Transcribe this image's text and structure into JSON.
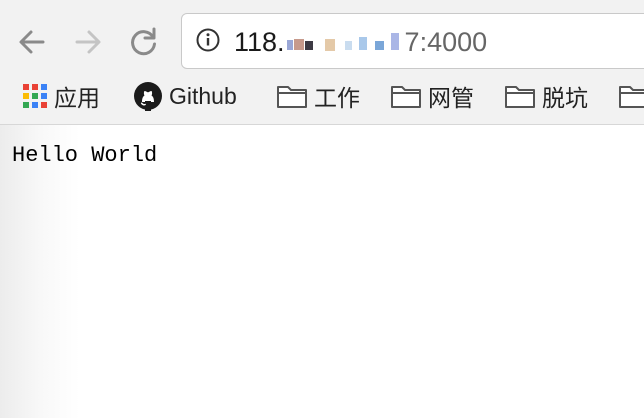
{
  "toolbar": {
    "url_prefix": "118.",
    "url_suffix": "7:4000"
  },
  "bookmarks": [
    {
      "label": "应用",
      "icon": "apps-grid-icon"
    },
    {
      "label": "Github",
      "icon": "github-icon"
    },
    {
      "label": "工作",
      "icon": "folder-icon"
    },
    {
      "label": "网管",
      "icon": "folder-icon"
    },
    {
      "label": "脱坑",
      "icon": "folder-icon"
    }
  ],
  "page": {
    "body_text": "Hello World"
  }
}
